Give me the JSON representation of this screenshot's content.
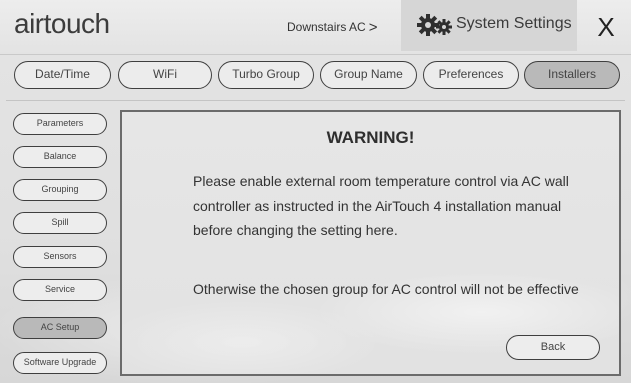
{
  "header": {
    "logo_text": "airtouch",
    "zone_label": "Downstairs AC",
    "zone_chevron": ">",
    "title": "System Settings",
    "close_label": "X"
  },
  "tabs": [
    {
      "label": "Date/Time",
      "active": false
    },
    {
      "label": "WiFi",
      "active": false
    },
    {
      "label": "Turbo Group",
      "active": false
    },
    {
      "label": "Group Name",
      "active": false
    },
    {
      "label": "Preferences",
      "active": false
    },
    {
      "label": "Installers",
      "active": true
    }
  ],
  "sidebar": {
    "items": [
      {
        "label": "Parameters",
        "active": false
      },
      {
        "label": "Balance",
        "active": false
      },
      {
        "label": "Grouping",
        "active": false
      },
      {
        "label": "Spill",
        "active": false
      },
      {
        "label": "Sensors",
        "active": false
      },
      {
        "label": "Service",
        "active": false
      },
      {
        "label": "AC Setup",
        "active": true
      },
      {
        "label": "Software Upgrade",
        "active": false
      }
    ]
  },
  "dialog": {
    "title": "WARNING!",
    "message_1": "Please enable external room temperature control via AC wall controller as instructed in the AirTouch 4 installation manual before changing the setting here.",
    "message_2": "Otherwise the chosen group for AC control will not be effective",
    "back_label": "Back"
  },
  "colors": {
    "active_fill": "#b9b9b9",
    "button_fill": "#ededed",
    "outline": "#3f3f3f",
    "title_bar": "#d6d6d6"
  }
}
